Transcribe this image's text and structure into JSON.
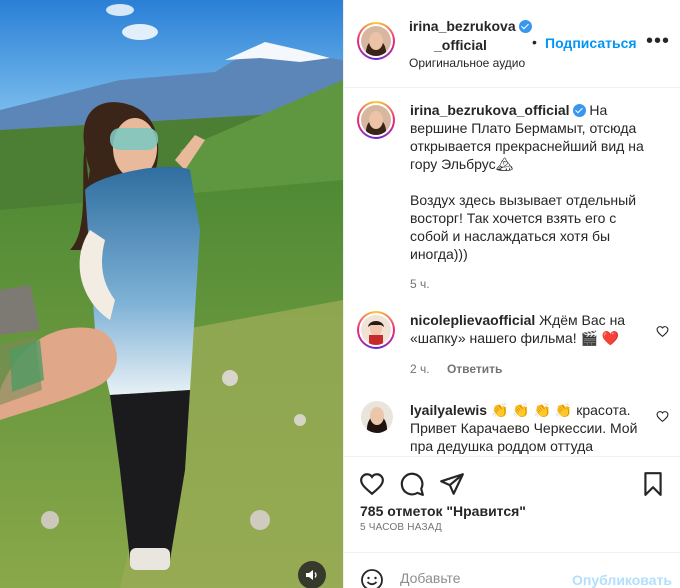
{
  "header": {
    "username_line1": "irina_bezrukova",
    "username_line2": "_official",
    "separator": "•",
    "follow_label": "Подписаться",
    "more_label": "•••",
    "audio_label": "Оригинальное аудио"
  },
  "caption": {
    "username": "irina_bezrukova_official",
    "text_p1": "На вершине Плато Бермамыт, отсюда открывается прекраснейший вид на гору Эльбрус🏔",
    "text_p2": "Воздух здесь вызывает отдельный восторг! Так хочется взять его с собой и наслаждаться хотя бы иногда)))",
    "time": "5 ч."
  },
  "comments": [
    {
      "username": "nicolepli evaofficial",
      "display_username": "nicoleplievaofficial",
      "text": "Ждём Вас на «шапку» нашего фильма! 🎬 ❤️",
      "time": "2 ч.",
      "reply_label": "Ответить"
    },
    {
      "username": "lyailyalewis",
      "text": "👏 👏 👏 👏 красота. Привет Карачаево Черкессии. Мой пра дедушка роддом оттуда"
    }
  ],
  "actions": {
    "like_icon": "heart-icon",
    "comment_icon": "comment-icon",
    "share_icon": "share-icon",
    "save_icon": "bookmark-icon"
  },
  "likes_text": "785 отметок \"Нравится\"",
  "timestamp": "5 ЧАСОВ НАЗАД",
  "add_comment": {
    "placeholder": "Добавьте",
    "post_label": "Опубликовать"
  },
  "colors": {
    "accent": "#0095f6",
    "post_disabled": "#b2dffc",
    "muted": "#737373"
  }
}
